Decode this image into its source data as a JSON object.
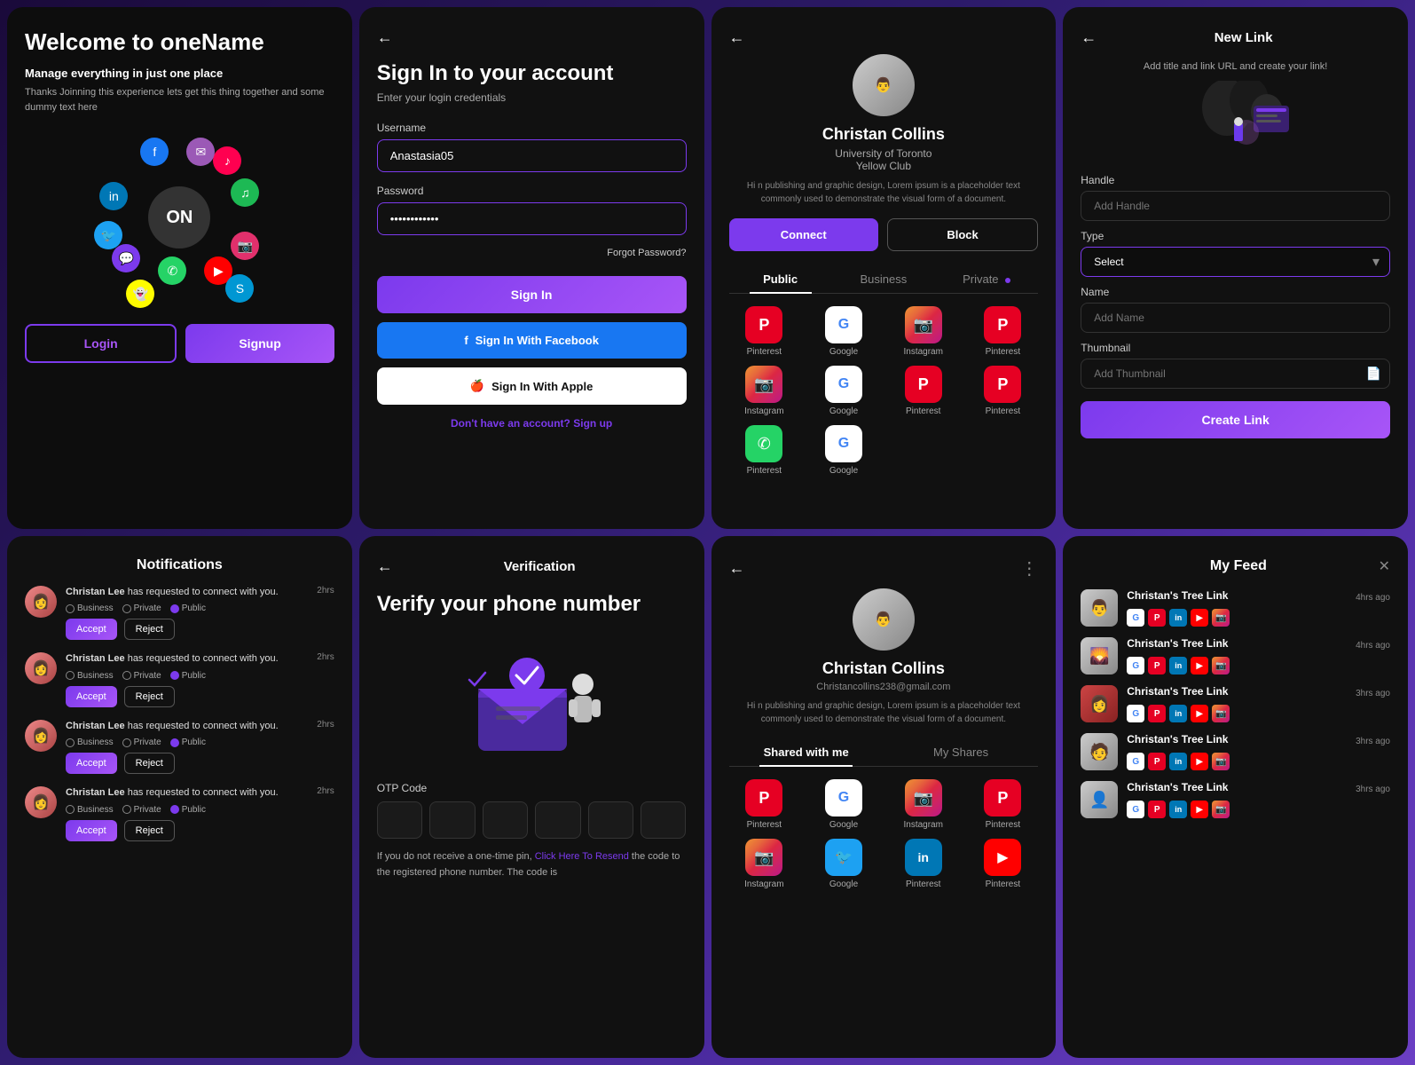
{
  "welcome": {
    "title": "Welcome to oneName",
    "subtitle": "Manage everything in just one place",
    "description": "Thanks Joinning this experience lets get this thing together and some dummy text here",
    "orbit_label": "ON",
    "login_label": "Login",
    "signup_label": "Signup"
  },
  "signin": {
    "title": "Sign In to your account",
    "subtitle": "Enter your login credentials",
    "username_label": "Username",
    "username_value": "Anastasia05",
    "password_label": "Password",
    "password_placeholder": "••••••••••••",
    "forgot_label": "Forgot Password?",
    "signin_label": "Sign In",
    "facebook_label": "Sign In With Facebook",
    "apple_label": "Sign In With Apple",
    "no_account": "Don't have an account?",
    "signup_link": "Sign up"
  },
  "profile": {
    "name": "Christan Collins",
    "university": "University of Toronto",
    "club": "Yellow Club",
    "bio": "Hi n publishing and graphic design, Lorem ipsum is a placeholder text commonly used to demonstrate the visual form of a document.",
    "connect_label": "Connect",
    "block_label": "Block",
    "tabs": [
      "Public",
      "Business",
      "Private"
    ],
    "active_tab": 0,
    "social_items": [
      {
        "name": "Pinterest",
        "icon": "P",
        "color": "pinterest"
      },
      {
        "name": "Google",
        "icon": "G",
        "color": "google"
      },
      {
        "name": "Instagram",
        "icon": "📷",
        "color": "instagram"
      },
      {
        "name": "Pinterest",
        "icon": "P",
        "color": "pinterest"
      },
      {
        "name": "Instagram",
        "icon": "📷",
        "color": "instagram"
      },
      {
        "name": "Google",
        "icon": "G",
        "color": "google"
      },
      {
        "name": "Pinterest",
        "icon": "P",
        "color": "pinterest"
      },
      {
        "name": "Pinterest",
        "icon": "P",
        "color": "pinterest"
      },
      {
        "name": "Pinterest",
        "icon": "P",
        "color": "whatsapp"
      },
      {
        "name": "Google",
        "icon": "G",
        "color": "google"
      }
    ]
  },
  "newlink": {
    "back": "←",
    "title": "New Link",
    "subtitle": "Add title and link URL and create your link!",
    "handle_label": "Handle",
    "handle_placeholder": "Add Handle",
    "type_label": "Type",
    "type_value": "Select",
    "name_label": "Name",
    "name_placeholder": "Add Name",
    "thumbnail_label": "Thumbnail",
    "thumbnail_placeholder": "Add Thumbnail",
    "create_label": "Create Link"
  },
  "notifications": {
    "title": "Notifications",
    "items": [
      {
        "user": "Christan Lee",
        "text": "has requested to connect with you.",
        "time": "2hrs",
        "radio": [
          "Business",
          "Private",
          "Public"
        ],
        "active_radio": 2,
        "accept": "Accept",
        "reject": "Reject"
      },
      {
        "user": "Christan Lee",
        "text": "has requested to connect with you.",
        "time": "2hrs",
        "radio": [
          "Business",
          "Private",
          "Public"
        ],
        "active_radio": 2,
        "accept": "Accept",
        "reject": "Reject"
      },
      {
        "user": "Christan Lee",
        "text": "has requested to connect with you.",
        "time": "2hrs",
        "radio": [
          "Business",
          "Private",
          "Public"
        ],
        "active_radio": 2,
        "accept": "Accept",
        "reject": "Reject"
      },
      {
        "user": "Christan Lee",
        "text": "has requested to connect with you.",
        "time": "2hrs",
        "radio": [
          "Business",
          "Private",
          "Public"
        ],
        "active_radio": 2,
        "accept": "Accept",
        "reject": "Reject"
      }
    ]
  },
  "verification": {
    "back": "←",
    "title": "Verification",
    "heading": "Verify your phone number",
    "otp_label": "OTP Code",
    "otp_count": 6,
    "resend_text": "If you do not receive a one-time pin, ",
    "resend_link": "Click Here To Resend",
    "resend_suffix": " the code to the registered phone number. The code is"
  },
  "shared_profile": {
    "name": "Christan Collins",
    "email": "Christancollins238@gmail.com",
    "bio": "Hi n publishing and graphic design, Lorem ipsum is a placeholder text commonly used to demonstrate the visual form of a document.",
    "tabs": [
      "Shared with me",
      "My Shares"
    ],
    "active_tab": 0,
    "social_items": [
      {
        "name": "Pinterest",
        "color": "pinterest"
      },
      {
        "name": "Google",
        "color": "google"
      },
      {
        "name": "Instagram",
        "color": "instagram"
      },
      {
        "name": "Pinterest",
        "color": "pinterest"
      },
      {
        "name": "Instagram",
        "color": "instagram"
      },
      {
        "name": "Google",
        "color": "twitter"
      },
      {
        "name": "Pinterest",
        "color": "linkedin"
      },
      {
        "name": "Pinterest",
        "color": "youtube"
      }
    ]
  },
  "myfeed": {
    "title": "My Feed",
    "items": [
      {
        "name": "Christan's Tree Link",
        "time": "4hrs ago",
        "icons": [
          "google",
          "pinterest",
          "linkedin",
          "youtube",
          "instagram"
        ]
      },
      {
        "name": "Christan's Tree Link",
        "time": "4hrs ago",
        "icons": [
          "google",
          "pinterest",
          "linkedin",
          "youtube",
          "instagram"
        ]
      },
      {
        "name": "Christan's Tree Link",
        "time": "3hrs ago",
        "icons": [
          "google",
          "pinterest",
          "linkedin",
          "youtube",
          "instagram"
        ]
      },
      {
        "name": "Christan's Tree Link",
        "time": "3hrs ago",
        "icons": [
          "google",
          "pinterest",
          "linkedin",
          "youtube",
          "instagram"
        ]
      },
      {
        "name": "Christan's Tree Link",
        "time": "3hrs ago",
        "icons": [
          "google",
          "pinterest",
          "linkedin",
          "youtube",
          "instagram"
        ]
      }
    ]
  }
}
